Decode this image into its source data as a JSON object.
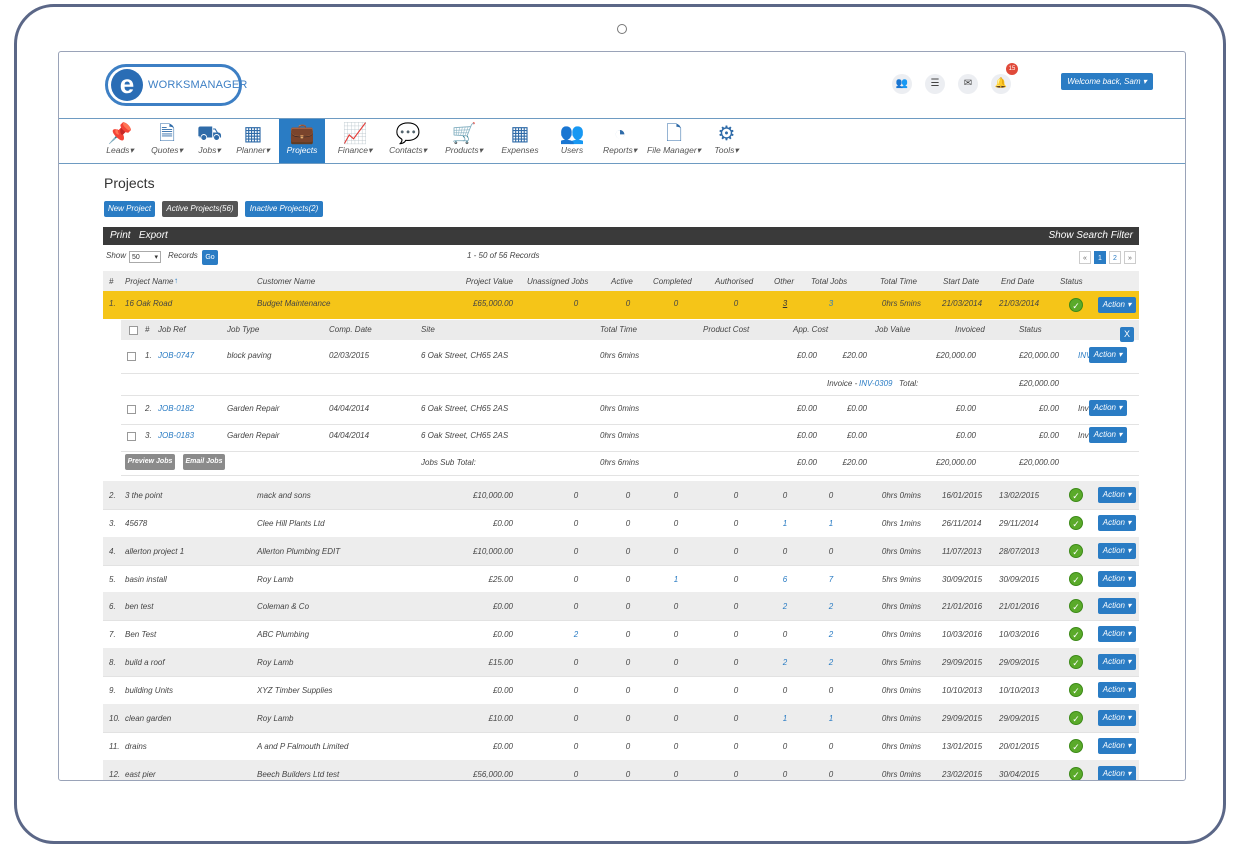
{
  "app": {
    "logo_text": "WORKSMANAGER",
    "logo_letter": "e",
    "notification_count": "15",
    "welcome": "Welcome back, Sam"
  },
  "nav": [
    {
      "label": "Leads",
      "icon": "📌",
      "dropdown": true
    },
    {
      "label": "Quotes",
      "icon": "🗎",
      "dropdown": true
    },
    {
      "label": "Jobs",
      "icon": "⛟",
      "dropdown": true
    },
    {
      "label": "Planner",
      "icon": "▦",
      "dropdown": true
    },
    {
      "label": "Projects",
      "icon": "💼",
      "dropdown": false,
      "active": true
    },
    {
      "label": "Finance",
      "icon": "📈",
      "dropdown": true
    },
    {
      "label": "Contacts",
      "icon": "💬",
      "dropdown": true
    },
    {
      "label": "Products",
      "icon": "🛒",
      "dropdown": true
    },
    {
      "label": "Expenses",
      "icon": "▦",
      "dropdown": false
    },
    {
      "label": "Users",
      "icon": "👥",
      "dropdown": false
    },
    {
      "label": "Reports",
      "icon": "◔",
      "dropdown": true
    },
    {
      "label": "File Manager",
      "icon": "🗋",
      "dropdown": true
    },
    {
      "label": "Tools",
      "icon": "⚙",
      "dropdown": true
    }
  ],
  "page": {
    "title": "Projects",
    "buttons": {
      "new": "New Project",
      "active": "Active Projects(56)",
      "inactive": "Inactive Projects(2)"
    },
    "toolbar": {
      "print": "Print",
      "export": "Export",
      "filter": "Show Search Filter"
    },
    "show_label": "Show",
    "show_value": "50",
    "records_label": "Records",
    "go": "Go",
    "records_info": "1 - 50 of 56 Records",
    "pagination": {
      "prev": "«",
      "p1": "1",
      "p2": "2",
      "next": "»"
    }
  },
  "table": {
    "headers": [
      "#",
      "Project Name",
      "Customer Name",
      "Project Value",
      "Unassigned Jobs",
      "Active",
      "Completed",
      "Authorised",
      "Other",
      "Total Jobs",
      "Total Time",
      "Start Date",
      "End Date",
      "Status"
    ],
    "sort_arrow": "↑",
    "action_label": "Action",
    "expanded": {
      "num": "1.",
      "name": "16 Oak Road",
      "customer": "Budget Maintenance",
      "value": "£65,000.00",
      "unassigned": "0",
      "active": "0",
      "completed": "0",
      "authorised": "0",
      "other": "3",
      "total": "3",
      "time": "0hrs 5mins",
      "start": "21/03/2014",
      "end": "21/03/2014"
    },
    "rows": [
      {
        "num": "2.",
        "name": "3 the point",
        "customer": "mack and sons",
        "value": "£10,000.00",
        "unassigned": "0",
        "active": "0",
        "completed": "0",
        "authorised": "0",
        "other": "0",
        "total": "0",
        "time": "0hrs 0mins",
        "start": "16/01/2015",
        "end": "13/02/2015"
      },
      {
        "num": "3.",
        "name": "45678",
        "customer": "Clee Hill Plants Ltd",
        "value": "£0.00",
        "unassigned": "0",
        "active": "0",
        "completed": "0",
        "authorised": "0",
        "other": "1",
        "total": "1",
        "time": "0hrs 1mins",
        "start": "26/11/2014",
        "end": "29/11/2014"
      },
      {
        "num": "4.",
        "name": "allerton project 1",
        "customer": "Allerton Plumbing EDIT",
        "value": "£10,000.00",
        "unassigned": "0",
        "active": "0",
        "completed": "0",
        "authorised": "0",
        "other": "0",
        "total": "0",
        "time": "0hrs 0mins",
        "start": "11/07/2013",
        "end": "28/07/2013"
      },
      {
        "num": "5.",
        "name": "basin install",
        "customer": "Roy Lamb",
        "value": "£25.00",
        "unassigned": "0",
        "active": "0",
        "completed": "1",
        "authorised": "0",
        "other": "6",
        "total": "7",
        "time": "5hrs 9mins",
        "start": "30/09/2015",
        "end": "30/09/2015"
      },
      {
        "num": "6.",
        "name": "ben test",
        "customer": "Coleman & Co",
        "value": "£0.00",
        "unassigned": "0",
        "active": "0",
        "completed": "0",
        "authorised": "0",
        "other": "2",
        "total": "2",
        "time": "0hrs 0mins",
        "start": "21/01/2016",
        "end": "21/01/2016"
      },
      {
        "num": "7.",
        "name": "Ben Test",
        "customer": "ABC Plumbing",
        "value": "£0.00",
        "unassigned": "2",
        "active": "0",
        "completed": "0",
        "authorised": "0",
        "other": "0",
        "total": "2",
        "time": "0hrs 0mins",
        "start": "10/03/2016",
        "end": "10/03/2016"
      },
      {
        "num": "8.",
        "name": "build a roof",
        "customer": "Roy Lamb",
        "value": "£15.00",
        "unassigned": "0",
        "active": "0",
        "completed": "0",
        "authorised": "0",
        "other": "2",
        "total": "2",
        "time": "0hrs 5mins",
        "start": "29/09/2015",
        "end": "29/09/2015"
      },
      {
        "num": "9.",
        "name": "building Units",
        "customer": "XYZ Timber Supplies",
        "value": "£0.00",
        "unassigned": "0",
        "active": "0",
        "completed": "0",
        "authorised": "0",
        "other": "0",
        "total": "0",
        "time": "0hrs 0mins",
        "start": "10/10/2013",
        "end": "10/10/2013"
      },
      {
        "num": "10.",
        "name": "clean garden",
        "customer": "Roy Lamb",
        "value": "£10.00",
        "unassigned": "0",
        "active": "0",
        "completed": "0",
        "authorised": "0",
        "other": "1",
        "total": "1",
        "time": "0hrs 0mins",
        "start": "29/09/2015",
        "end": "29/09/2015"
      },
      {
        "num": "11.",
        "name": "drains",
        "customer": "A and P Falmouth Limited",
        "value": "£0.00",
        "unassigned": "0",
        "active": "0",
        "completed": "0",
        "authorised": "0",
        "other": "0",
        "total": "0",
        "time": "0hrs 0mins",
        "start": "13/01/2015",
        "end": "20/01/2015"
      },
      {
        "num": "12.",
        "name": "east pier",
        "customer": "Beech Builders Ltd test",
        "value": "£56,000.00",
        "unassigned": "0",
        "active": "0",
        "completed": "0",
        "authorised": "0",
        "other": "0",
        "total": "0",
        "time": "0hrs 0mins",
        "start": "23/02/2015",
        "end": "30/04/2015"
      }
    ]
  },
  "subtable": {
    "headers": [
      "#",
      "Job Ref",
      "Job Type",
      "Comp. Date",
      "Site",
      "Total Time",
      "Product Cost",
      "App. Cost",
      "Job Value",
      "Invoiced",
      "Status"
    ],
    "close": "X",
    "jobs": [
      {
        "num": "1.",
        "ref": "JOB-0747",
        "type": "block paving",
        "date": "02/03/2015",
        "site": "6 Oak Street, CH65 2AS",
        "time": "0hrs 6mins",
        "product": "£0.00",
        "app": "£20.00",
        "value": "£20,000.00",
        "invoiced": "£20,000.00",
        "status": "INV-0309"
      },
      {
        "num": "2.",
        "ref": "JOB-0182",
        "type": "Garden Repair",
        "date": "04/04/2014",
        "site": "6 Oak Street, CH65 2AS",
        "time": "0hrs 0mins",
        "product": "£0.00",
        "app": "£0.00",
        "value": "£0.00",
        "invoiced": "£0.00",
        "status": "Invoiced"
      },
      {
        "num": "3.",
        "ref": "JOB-0183",
        "type": "Garden Repair",
        "date": "04/04/2014",
        "site": "6 Oak Street, CH65 2AS",
        "time": "0hrs 0mins",
        "product": "£0.00",
        "app": "£0.00",
        "value": "£0.00",
        "invoiced": "£0.00",
        "status": "Invoiced"
      }
    ],
    "invoice_line": {
      "prefix": "Invoice - ",
      "ref": "INV-0309",
      "total_label": "Total:",
      "total": "£20,000.00"
    },
    "footer": {
      "preview": "Preview Jobs",
      "email": "Email Jobs",
      "subtotal_label": "Jobs Sub Total:",
      "time": "0hrs 6mins",
      "product": "£0.00",
      "app": "£20.00",
      "value": "£20,000.00",
      "invoiced": "£20,000.00"
    }
  },
  "colors": {
    "accent": "#2a7cc4",
    "highlight": "#f5c518",
    "toolbar": "#3a3a3a",
    "status_ok": "#5aaa2a"
  }
}
